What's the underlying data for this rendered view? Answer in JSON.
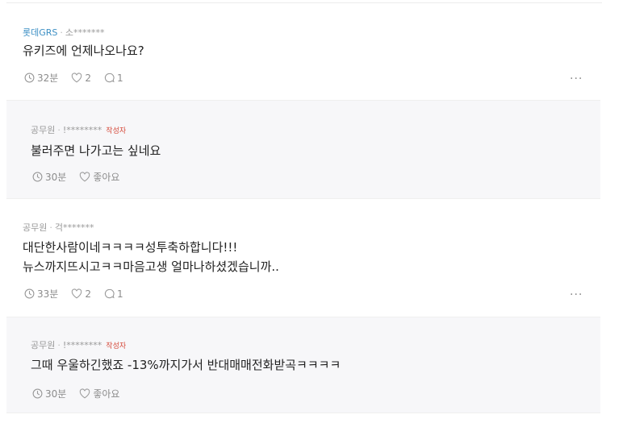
{
  "comments": [
    {
      "company": "롯데GRS",
      "author": "소*******",
      "text": [
        "유키즈에 언제나오나요?"
      ],
      "time": "32분",
      "likes": "2",
      "replies": "1"
    },
    {
      "company": "공무원",
      "author": "!********",
      "author_tag": "작성자",
      "text": [
        "불러주면 나가고는 싶네요"
      ],
      "time": "30분",
      "like_label": "좋아요"
    },
    {
      "company": "공무원",
      "author": "걱*******",
      "text": [
        "대단한사람이네ㅋㅋㅋㅋ성투축하합니다!!!",
        "뉴스까지뜨시고ㅋㅋ마음고생 얼마나하셨겠습니까.."
      ],
      "time": "33분",
      "likes": "2",
      "replies": "1"
    },
    {
      "company": "공무원",
      "author": "!********",
      "author_tag": "작성자",
      "text": [
        "그때 우울하긴했죠 -13%까지가서 반대매매전화받곡ㅋㅋㅋㅋ"
      ],
      "time": "30분",
      "like_label": "좋아요"
    }
  ],
  "more_label": "···"
}
